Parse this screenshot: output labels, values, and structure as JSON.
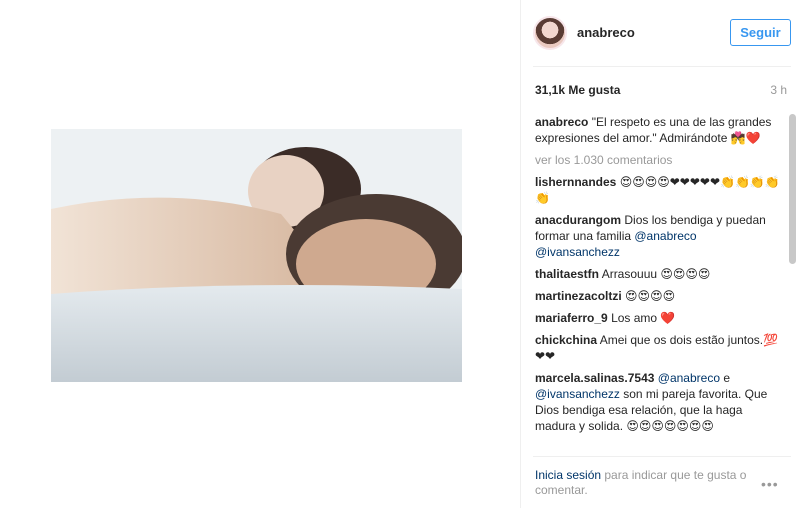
{
  "post": {
    "username": "anabreco",
    "follow_label": "Seguir",
    "likes": "31,1k Me gusta",
    "time_ago": "3 h",
    "caption": {
      "user": "anabreco",
      "text": "\"El respeto es una de las grandes expresiones del amor.\" Admirándote 💏❤️"
    },
    "view_comments": "ver los 1.030 comentarios",
    "comments": [
      {
        "user": "lishernnandes",
        "text": "😍😍😍😍❤❤❤❤❤👏👏👏👏👏"
      },
      {
        "user": "anacdurangom",
        "text": "Dios los bendiga y puedan formar una familia ",
        "mentions": [
          "@anabreco",
          "@ivansanchezz"
        ]
      },
      {
        "user": "thalitaestfn",
        "text": "Arrasouuu 😍😍😍😍"
      },
      {
        "user": "martinezacoltzi",
        "text": "😍😍😍😍"
      },
      {
        "user": "mariaferro_9",
        "text": "Los amo ❤️"
      },
      {
        "user": "chickchina",
        "text": "Amei que os dois estão juntos.💯❤❤"
      },
      {
        "user": "marcela.salinas.7543",
        "mention_a": "@anabreco",
        "joiner": " e ",
        "mention_b": "@ivansanchezz",
        "text": " son mi pareja favorita. Que Dios bendiga esa relación, que la haga madura y solida. 😍😍😍😍😍😍😍"
      }
    ],
    "footer": {
      "login_label": "Inicia sesión",
      "rest": " para indicar que te gusta o comentar."
    },
    "more_options": "•••"
  },
  "colors": {
    "accent": "#3897f0",
    "link": "#003569",
    "muted": "#999999"
  }
}
